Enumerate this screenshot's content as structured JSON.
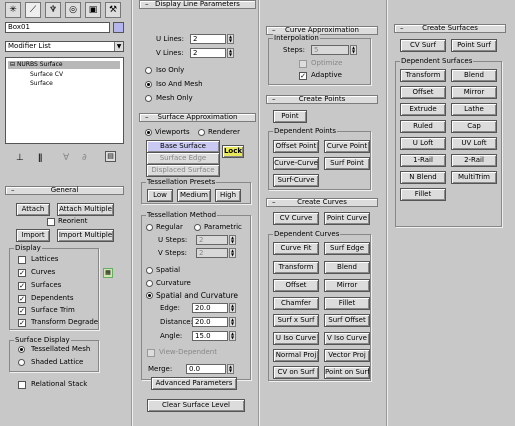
{
  "left": {
    "object_name": "Box01",
    "modifier_list": "Modifier List",
    "stack": [
      "NURBS Surface",
      "Surface CV",
      "Surface"
    ],
    "general": {
      "title": "General",
      "attach": "Attach",
      "attach_multiple": "Attach Multiple",
      "reorient": "Reorient",
      "import": "Import",
      "import_multiple": "Import Multiple",
      "display_title": "Display",
      "display_items": [
        "Lattices",
        "Curves",
        "Surfaces",
        "Dependents",
        "Surface Trim",
        "Transform Degrade"
      ],
      "display_checked": [
        false,
        true,
        true,
        true,
        true,
        true
      ],
      "surface_display_title": "Surface Display",
      "tess_mesh": "Tessellated Mesh",
      "shaded_lattice": "Shaded Lattice",
      "relational_stack": "Relational Stack"
    }
  },
  "middle": {
    "display_line": {
      "title": "Display Line Parameters",
      "u_lines_label": "U Lines:",
      "u_lines": "2",
      "v_lines_label": "V Lines:",
      "v_lines": "2",
      "iso_only": "Iso Only",
      "iso_and_mesh": "Iso And Mesh",
      "mesh_only": "Mesh Only"
    },
    "surface_approx": {
      "title": "Surface Approximation",
      "viewports": "Viewports",
      "renderer": "Renderer",
      "base_surface": "Base Surface",
      "lock": "Lock",
      "surface_edge": "Surface Edge",
      "displaced_surface": "Displaced Surface",
      "presets_title": "Tessellation Presets",
      "low": "Low",
      "medium": "Medium",
      "high": "High",
      "method_title": "Tessellation Method",
      "regular": "Regular",
      "parametric": "Parametric",
      "u_steps_label": "U Steps:",
      "u_steps": "2",
      "v_steps_label": "V Steps:",
      "v_steps": "2",
      "spatial": "Spatial",
      "curvature": "Curvature",
      "spatial_and_curvature": "Spatial and Curvature",
      "edge_label": "Edge:",
      "edge": "20.0",
      "distance_label": "Distance:",
      "distance": "20.0",
      "angle_label": "Angle:",
      "angle": "15.0",
      "view_dependent": "View-Dependent",
      "merge_label": "Merge:",
      "merge": "0.0",
      "advanced": "Advanced Parameters",
      "clear": "Clear Surface Level"
    }
  },
  "curve_col": {
    "curve_approx": {
      "title": "Curve Approximation",
      "interp_title": "Interpolation",
      "steps_label": "Steps:",
      "steps": "5",
      "optimize": "Optimize",
      "adaptive": "Adaptive"
    },
    "create_points": {
      "title": "Create Points",
      "point": "Point",
      "dependent_title": "Dependent Points",
      "buttons": [
        "Offset Point",
        "Curve Point",
        "Curve-Curve",
        "Surf Point",
        "Surf-Curve"
      ]
    },
    "create_curves": {
      "title": "Create Curves",
      "cv_curve": "CV Curve",
      "point_curve": "Point Curve",
      "dependent_title": "Dependent Curves",
      "buttons": [
        "Curve Fit",
        "Surf Edge",
        "Transform",
        "Blend",
        "Offset",
        "Mirror",
        "Chamfer",
        "Fillet",
        "Surf x Surf",
        "Surf Offset",
        "U Iso Curve",
        "V Iso Curve",
        "Normal Proj",
        "Vector Proj",
        "CV on Surf",
        "Point on Surf"
      ]
    }
  },
  "surf_col": {
    "title": "Create Surfaces",
    "cv_surf": "CV Surf",
    "point_surf": "Point Surf",
    "dependent_title": "Dependent Surfaces",
    "buttons": [
      "Transform",
      "Blend",
      "Offset",
      "Mirror",
      "Extrude",
      "Lathe",
      "Ruled",
      "Cap",
      "U Loft",
      "UV Loft",
      "1-Rail",
      "2-Rail",
      "N Blend",
      "MultiTrim",
      "Fillet"
    ]
  }
}
